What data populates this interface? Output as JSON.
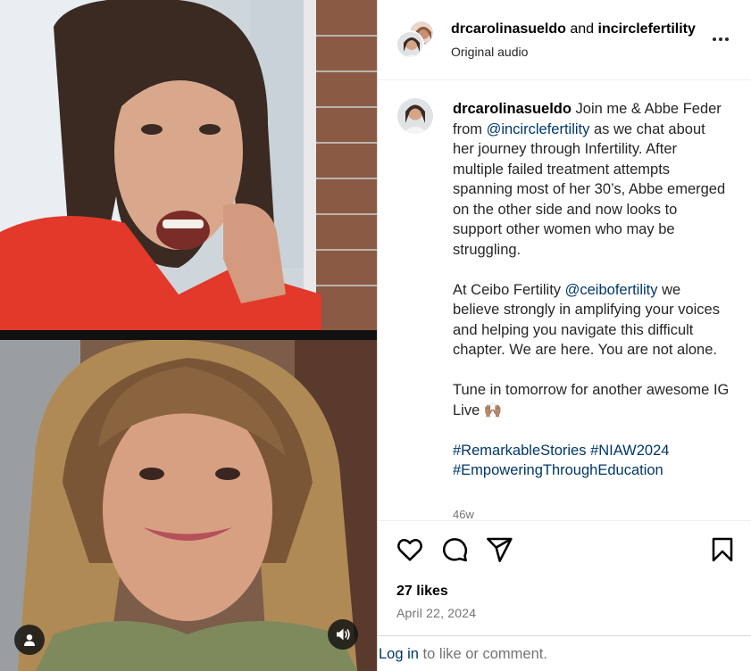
{
  "post": {
    "authors": {
      "primary": "drcarolinasueldo",
      "joiner": "and",
      "secondary": "incirclefertility"
    },
    "audio_label": "Original audio",
    "caption": {
      "username": "drcarolinasueldo",
      "para1_a": " Join me & Abbe Feder from ",
      "mention1": "@incirclefertility",
      "para1_b": " as we chat about her journey through Infertility. After multiple failed treatment attempts spanning most of her 30’s, Abbe emerged on the other side and now looks to support other women who may be struggling.",
      "para2_a": "At Ceibo Fertility ",
      "mention2": "@ceibofertility",
      "para2_b": " we believe strongly in amplifying your voices and helping you navigate this difficult chapter. We are here. You are not alone.",
      "para3": "Tune in tomorrow for another awesome IG Live 🙌🏽",
      "hashtag1": "#RemarkableStories",
      "hashtag2": "#NIAW2024",
      "hashtag3": "#EmpoweringThroughEducation"
    },
    "timestamp": "46w",
    "likes": "27 likes",
    "date": "April 22, 2024"
  },
  "footer": {
    "login_link": "Log in",
    "rest": " to like or comment."
  },
  "icons": {
    "more": "more-horizontal-icon",
    "like": "heart-icon",
    "comment": "comment-bubble-icon",
    "share": "paper-plane-icon",
    "save": "bookmark-icon",
    "user": "user-icon",
    "audio": "speaker-icon"
  },
  "colors": {
    "link": "#00376b",
    "muted": "#737373",
    "text": "#262626",
    "border": "#dbdbdb"
  }
}
